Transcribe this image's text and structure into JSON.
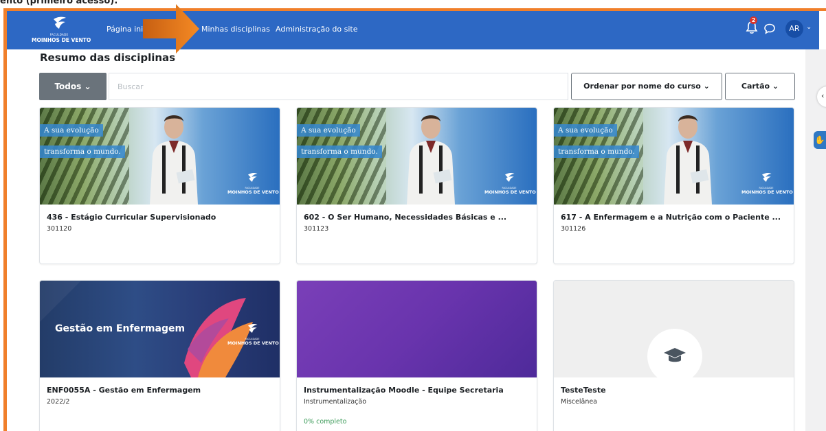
{
  "caption": "ento (primeiro acesso):",
  "navbar": {
    "logo_small": "FACULDADE",
    "logo_name": "MOINHOS DE VENTO",
    "links": [
      "Página inicial",
      "Minhas disciplinas",
      "Administração do site"
    ],
    "notification_count": "2",
    "avatar_initials": "AR",
    "user_caret": "⌄"
  },
  "colors": {
    "navbar": "#2d68c4",
    "highlight_border": "#f07f2a",
    "progress": "#3d9b5a"
  },
  "page": {
    "title": "Resumo das disciplinas"
  },
  "toolbar": {
    "filter_label": "Todos ⌄",
    "search_placeholder": "Buscar",
    "sort_label": "Ordenar por nome do curso ⌄",
    "view_label": "Cartão ⌄"
  },
  "banner_text": {
    "line1": "A sua evolução",
    "line2": "transforma o mundo.",
    "gestao": "Gestão em Enfermagem"
  },
  "courses": [
    {
      "title": "436 - Estágio Curricular Supervisionado",
      "sub": "301120",
      "progress": ""
    },
    {
      "title": "602 - O Ser Humano, Necessidades Básicas e ...",
      "sub": "301123",
      "progress": ""
    },
    {
      "title": "617 - A Enfermagem e a Nutrição com o Paciente ...",
      "sub": "301126",
      "progress": ""
    },
    {
      "title": "ENF0055A - Gestão em Enfermagem",
      "sub": "2022/2",
      "progress": ""
    },
    {
      "title": "Instrumentalização Moodle - Equipe Secretaria",
      "sub": "Instrumentalização",
      "progress": "0% completo"
    },
    {
      "title": "TesteTeste",
      "sub": "Miscelânea",
      "progress": ""
    }
  ],
  "icons": {
    "bell": "bell-icon",
    "chat": "chat-icon",
    "graduation": "graduation-cap-icon",
    "sidebar_toggle": "chevron-left-icon",
    "accessibility": "hand-icon"
  }
}
